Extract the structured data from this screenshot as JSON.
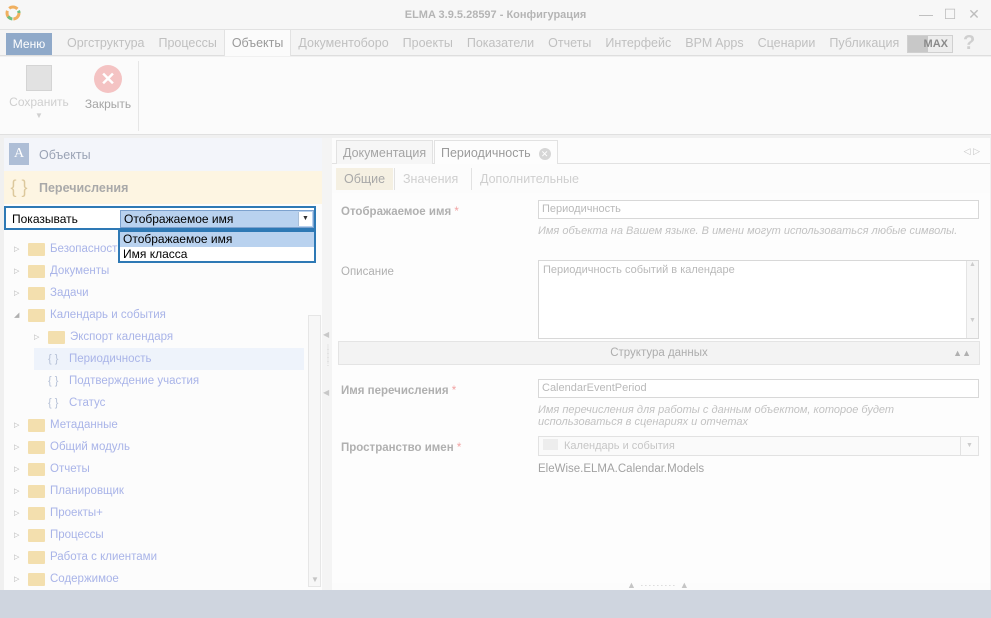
{
  "window": {
    "title": "ELMA 3.9.5.28597 - Конфигурация"
  },
  "menubar": {
    "menu_label": "Меню",
    "tabs": [
      "Оргструктура",
      "Процессы",
      "Объекты",
      "Документоборо",
      "Проекты",
      "Показатели",
      "Отчеты",
      "Интерфейс",
      "BPM Apps",
      "Сценарии",
      "Публикация"
    ],
    "active_tab": "Объекты",
    "max_label": "MAX"
  },
  "ribbon": {
    "save_label": "Сохранить",
    "close_label": "Закрыть"
  },
  "left": {
    "objects_label": "Объекты",
    "enums_label": "Перечисления",
    "show_label": "Показывать",
    "show_value": "Отображаемое имя",
    "dropdown_options": [
      "Отображаемое имя",
      "Имя класса"
    ],
    "tree": [
      "Безопасность",
      "Документы",
      "Задачи",
      "Календарь и события",
      "Экспорт календаря",
      "Периодичность",
      "Подтверждение участия",
      "Статус",
      "Метаданные",
      "Общий модуль",
      "Отчеты",
      "Планировщик",
      "Проекты+",
      "Процессы",
      "Работа с клиентами",
      "Содержимое"
    ]
  },
  "right": {
    "doc_tabs": [
      "Документация",
      "Периодичность"
    ],
    "sub_tabs": [
      "Общие",
      "Значения",
      "Дополнительные"
    ],
    "display_name_label": "Отображаемое имя",
    "display_name_value": "Периодичность",
    "display_name_hint": "Имя объекта на Вашем языке. В имени могут использоваться любые символы.",
    "description_label": "Описание",
    "description_value": "Периодичность событий в календаре",
    "group_label": "Структура данных",
    "enum_name_label": "Имя перечисления",
    "enum_name_value": "CalendarEventPeriod",
    "enum_name_hint": "Имя перечисления для работы с данным объектом, которое будет использоваться в сценариях и отчетах",
    "namespace_label": "Пространство имен",
    "namespace_value": "Календарь и события",
    "namespace_full": "EleWise.ELMA.Calendar.Models",
    "required_mark": "*"
  }
}
